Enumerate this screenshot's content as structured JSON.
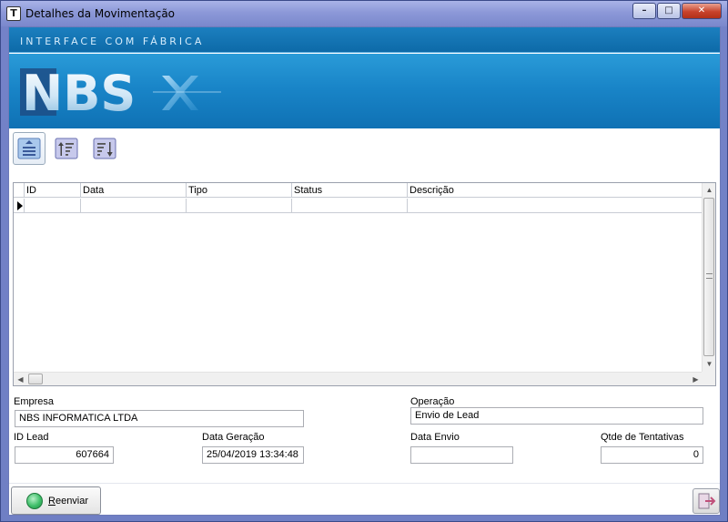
{
  "window": {
    "title": "Detalhes da Movimentação",
    "icon": "tf-app-icon",
    "controls": [
      "minimize-icon",
      "maximize-icon",
      "close-icon"
    ]
  },
  "banner": {
    "caption": "INTERFACE COM FÁBRICA",
    "logo_text": "NBS"
  },
  "toolbar": {
    "buttons": [
      {
        "icon": "list-view-icon",
        "active": true
      },
      {
        "icon": "sort-ascending-icon",
        "active": false
      },
      {
        "icon": "sort-descending-icon",
        "active": false
      }
    ]
  },
  "grid": {
    "columns": [
      "ID",
      "Data",
      "Tipo",
      "Status",
      "Descrição"
    ],
    "rows": [
      [
        "",
        "",
        "",
        "",
        ""
      ]
    ]
  },
  "form": {
    "empresa_label": "Empresa",
    "empresa_value": "NBS INFORMATICA LTDA",
    "operacao_label": "Operação",
    "operacao_value": "Envio de Lead",
    "id_lead_label": "ID Lead",
    "id_lead_value": "607664",
    "data_geracao_label": "Data Geração",
    "data_geracao_value": "25/04/2019 13:34:48",
    "data_envio_label": "Data Envio",
    "data_envio_value": "",
    "tentativas_label": "Qtde de Tentativas",
    "tentativas_value": "0"
  },
  "actions": {
    "reenviar_label_mnemonic": "R",
    "reenviar_label_rest": "eenviar",
    "exit_icon": "exit-door-icon"
  },
  "colors": {
    "banner_blue": "#1985c8",
    "title_bar": "#8c98d8",
    "close_red": "#c8432c"
  }
}
